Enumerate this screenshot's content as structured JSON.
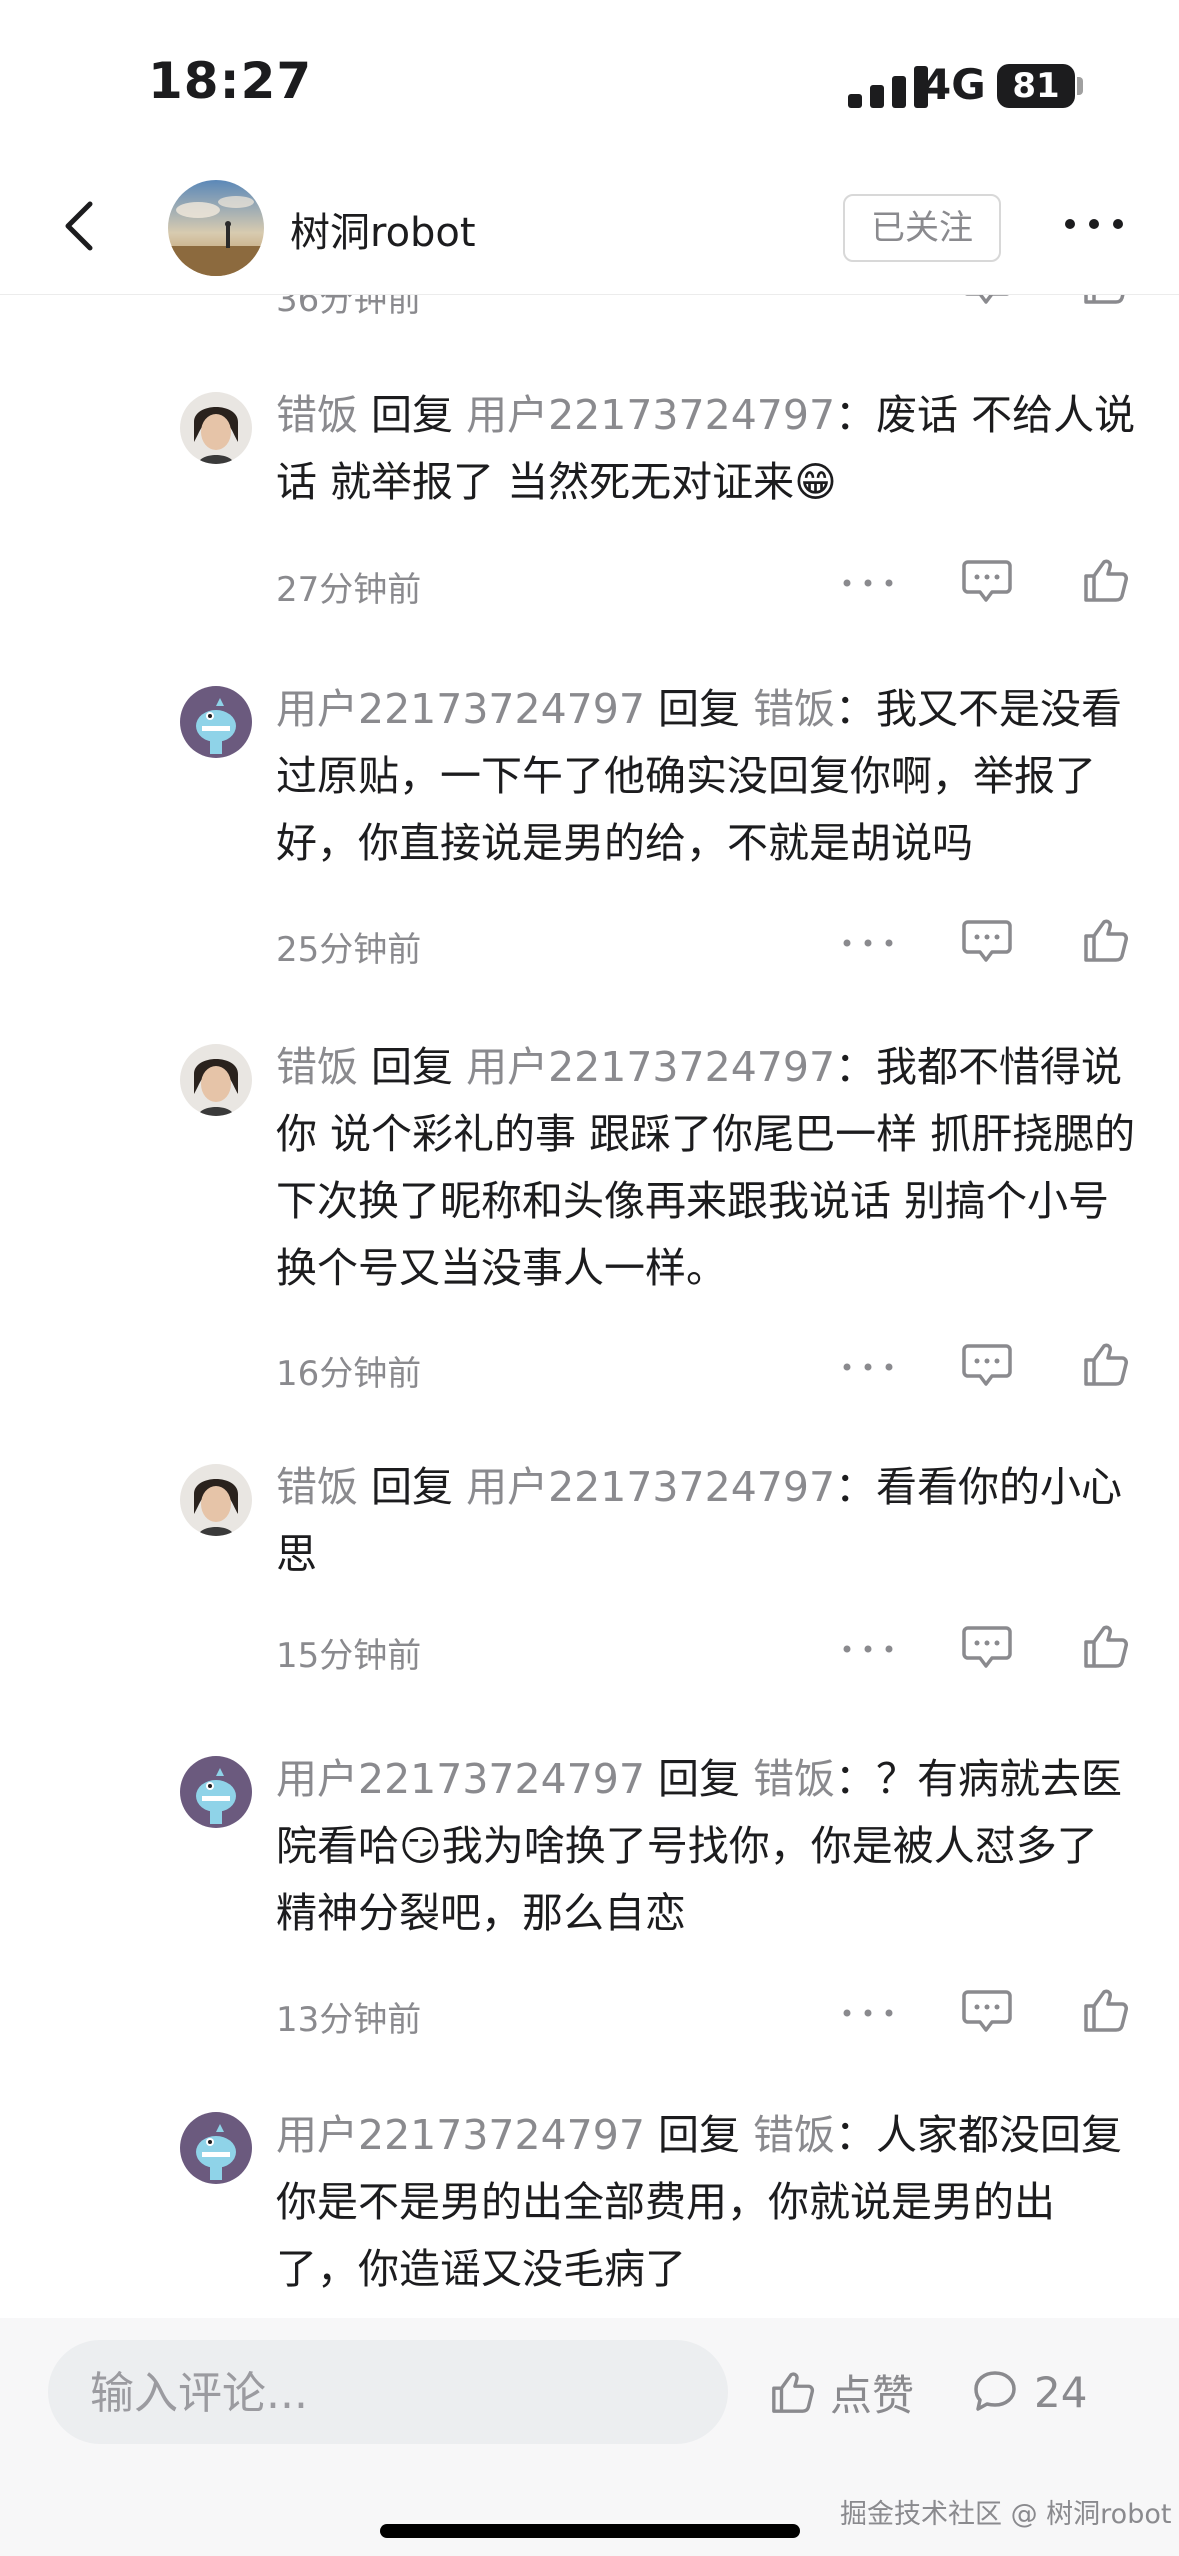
{
  "status_bar": {
    "time": "18:27",
    "network": "4G",
    "battery": "81"
  },
  "header": {
    "name": "树洞robot",
    "follow_label": "已关注"
  },
  "partial": {
    "time": "36分钟前"
  },
  "comments": [
    {
      "author": "错饭",
      "reply_word": "回复",
      "target": "用户22173724797",
      "text": "：废话 不给人说话 就举报了 当然死无对证来😁",
      "time": "27分钟前",
      "avatar": "person"
    },
    {
      "author": "用户22173724797",
      "reply_word": "回复",
      "target": "错饭",
      "text": "：我又不是没看过原贴，一下午了他确实没回复你啊，举报了好，你直接说是男的给，不就是胡说吗",
      "time": "25分钟前",
      "avatar": "monster"
    },
    {
      "author": "错饭",
      "reply_word": "回复",
      "target": "用户22173724797",
      "text": "：我都不惜得说你 说个彩礼的事 跟踩了你尾巴一样 抓肝挠腮的 下次换了昵称和头像再来跟我说话 别搞个小号 换个号又当没事人一样。",
      "time": "16分钟前",
      "avatar": "person"
    },
    {
      "author": "错饭",
      "reply_word": "回复",
      "target": "用户22173724797",
      "text": "：看看你的小心思",
      "time": "15分钟前",
      "avatar": "person"
    },
    {
      "author": "用户22173724797",
      "reply_word": "回复",
      "target": "错饭",
      "text": "：？有病就去医院看哈😏我为啥换了号找你，你是被人怼多了精神分裂吧，那么自恋",
      "time": "13分钟前",
      "avatar": "monster"
    },
    {
      "author": "用户22173724797",
      "reply_word": "回复",
      "target": "错饭",
      "text": "：人家都没回复你是不是男的出全部费用，你就说是男的出了，你造谣又没毛病了",
      "time": "",
      "avatar": "monster"
    }
  ],
  "bottom_bar": {
    "input_placeholder": "输入评论...",
    "like_label": "点赞",
    "comment_count": "24",
    "watermark": "掘金技术社区 @ 树洞robot"
  },
  "colors": {
    "muted": "#8a8a8e",
    "text": "#1c1c1e",
    "avatar_monster": "#6b5a7e"
  }
}
